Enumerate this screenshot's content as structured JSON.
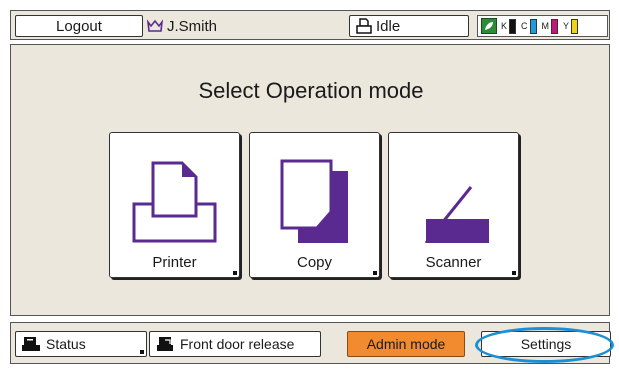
{
  "topbar": {
    "logout_label": "Logout",
    "user_name": "J.Smith",
    "status_label": "Idle",
    "inks": [
      {
        "label": "K",
        "color": "#111111"
      },
      {
        "label": "C",
        "color": "#1e9be0"
      },
      {
        "label": "M",
        "color": "#c2187a"
      },
      {
        "label": "Y",
        "color": "#f1d21b"
      }
    ]
  },
  "main": {
    "title": "Select Operation mode",
    "modes": [
      {
        "label": "Printer",
        "icon": "printer-icon"
      },
      {
        "label": "Copy",
        "icon": "copy-icon"
      },
      {
        "label": "Scanner",
        "icon": "scanner-icon"
      }
    ]
  },
  "bottom": {
    "status_label": "Status",
    "front_door_label": "Front door release",
    "admin_label": "Admin mode",
    "settings_label": "Settings"
  },
  "colors": {
    "accent_purple": "#5b2a91",
    "admin_orange": "#f28a30",
    "highlight_blue": "#1b8fd6",
    "panel_bg": "#ebe7dc"
  }
}
